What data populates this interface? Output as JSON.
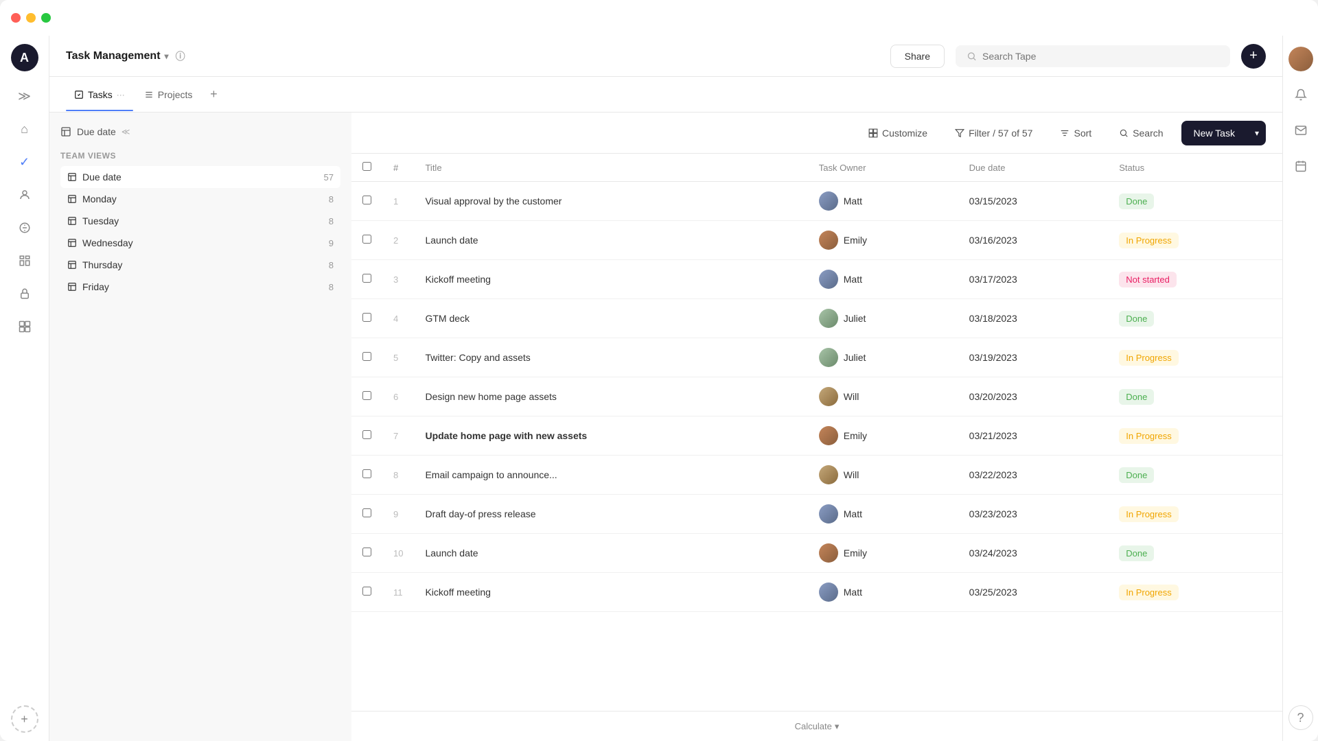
{
  "window": {
    "title": "Task Management"
  },
  "titlebar": {
    "traffic_lights": [
      "red",
      "yellow",
      "green"
    ]
  },
  "header": {
    "app_title": "Task Management",
    "share_label": "Share",
    "search_placeholder": "Search Tape",
    "info_icon": "ℹ",
    "chevron_icon": "⌄"
  },
  "nav": {
    "tabs": [
      {
        "label": "Tasks",
        "active": true
      },
      {
        "label": "Projects",
        "active": false
      }
    ],
    "add_label": "+"
  },
  "sidebar": {
    "avatar_letter": "A",
    "items": [
      {
        "icon": "≫",
        "name": "collapse",
        "active": false
      },
      {
        "icon": "⌂",
        "name": "home",
        "active": false
      },
      {
        "icon": "✓",
        "name": "tasks",
        "active": true
      },
      {
        "icon": "👤",
        "name": "user",
        "active": false
      },
      {
        "icon": "$",
        "name": "finance",
        "active": false
      },
      {
        "icon": "▦",
        "name": "grid",
        "active": false
      },
      {
        "icon": "🔒",
        "name": "lock",
        "active": false
      },
      {
        "icon": "⊞",
        "name": "apps",
        "active": false
      }
    ],
    "add_label": "+"
  },
  "right_sidebar": {
    "items": [
      {
        "icon": "🔔",
        "name": "notifications"
      },
      {
        "icon": "✉",
        "name": "messages"
      },
      {
        "icon": "📅",
        "name": "calendar"
      },
      {
        "icon": "?",
        "name": "help"
      }
    ]
  },
  "left_panel": {
    "due_date_label": "Due date",
    "team_views_label": "Team views",
    "views": [
      {
        "label": "Due date",
        "count": "57",
        "active": true
      },
      {
        "label": "Monday",
        "count": "8",
        "active": false
      },
      {
        "label": "Tuesday",
        "count": "8",
        "active": false
      },
      {
        "label": "Wednesday",
        "count": "9",
        "active": false
      },
      {
        "label": "Thursday",
        "count": "8",
        "active": false
      },
      {
        "label": "Friday",
        "count": "8",
        "active": false
      }
    ]
  },
  "toolbar": {
    "customize_label": "Customize",
    "filter_label": "Filter / 57 of 57",
    "sort_label": "Sort",
    "search_label": "Search",
    "new_task_label": "New Task"
  },
  "table": {
    "columns": [
      {
        "label": ""
      },
      {
        "label": "#"
      },
      {
        "label": "Title"
      },
      {
        "label": "Task Owner"
      },
      {
        "label": "Due date"
      },
      {
        "label": "Status"
      }
    ],
    "rows": [
      {
        "num": "1",
        "title": "Visual approval by the customer",
        "bold": false,
        "owner": "Matt",
        "owner_type": "matt",
        "due_date": "03/15/2023",
        "status": "Done",
        "status_type": "done"
      },
      {
        "num": "2",
        "title": "Launch date",
        "bold": false,
        "owner": "Emily",
        "owner_type": "emily",
        "due_date": "03/16/2023",
        "status": "In Progress",
        "status_type": "in-progress"
      },
      {
        "num": "3",
        "title": "Kickoff meeting",
        "bold": false,
        "owner": "Matt",
        "owner_type": "matt",
        "due_date": "03/17/2023",
        "status": "Not started",
        "status_type": "not-started"
      },
      {
        "num": "4",
        "title": "GTM deck",
        "bold": false,
        "owner": "Juliet",
        "owner_type": "juliet",
        "due_date": "03/18/2023",
        "status": "Done",
        "status_type": "done"
      },
      {
        "num": "5",
        "title": "Twitter: Copy and assets",
        "bold": false,
        "owner": "Juliet",
        "owner_type": "juliet",
        "due_date": "03/19/2023",
        "status": "In Progress",
        "status_type": "in-progress"
      },
      {
        "num": "6",
        "title": "Design new home page assets",
        "bold": false,
        "owner": "Will",
        "owner_type": "will",
        "due_date": "03/20/2023",
        "status": "Done",
        "status_type": "done"
      },
      {
        "num": "7",
        "title": "Update home page with new assets",
        "bold": true,
        "owner": "Emily",
        "owner_type": "emily",
        "due_date": "03/21/2023",
        "status": "In Progress",
        "status_type": "in-progress"
      },
      {
        "num": "8",
        "title": "Email campaign to announce...",
        "bold": false,
        "owner": "Will",
        "owner_type": "will",
        "due_date": "03/22/2023",
        "status": "Done",
        "status_type": "done"
      },
      {
        "num": "9",
        "title": "Draft day-of press release",
        "bold": false,
        "owner": "Matt",
        "owner_type": "matt",
        "due_date": "03/23/2023",
        "status": "In Progress",
        "status_type": "in-progress"
      },
      {
        "num": "10",
        "title": "Launch date",
        "bold": false,
        "owner": "Emily",
        "owner_type": "emily",
        "due_date": "03/24/2023",
        "status": "Done",
        "status_type": "done"
      },
      {
        "num": "11",
        "title": "Kickoff meeting",
        "bold": false,
        "owner": "Matt",
        "owner_type": "matt",
        "due_date": "03/25/2023",
        "status": "In Progress",
        "status_type": "in-progress"
      }
    ]
  },
  "calculate_label": "Calculate"
}
